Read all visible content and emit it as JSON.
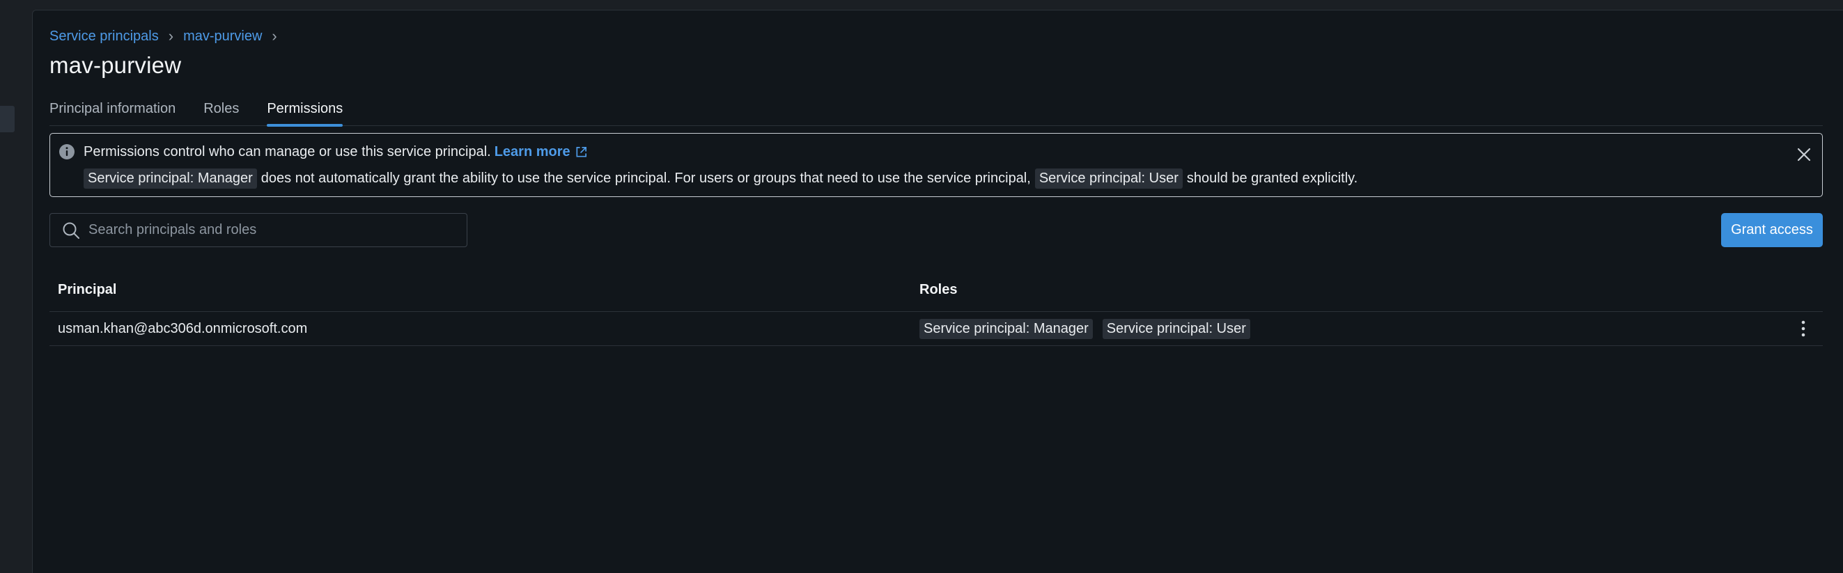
{
  "breadcrumb": {
    "items": [
      "Service principals",
      "mav-purview"
    ],
    "separator": "›"
  },
  "page": {
    "title": "mav-purview"
  },
  "tabs": [
    {
      "label": "Principal information",
      "active": false
    },
    {
      "label": "Roles",
      "active": false
    },
    {
      "label": "Permissions",
      "active": true
    }
  ],
  "alert": {
    "icon": "info-icon",
    "line1_text": "Permissions control who can manage or use this service principal.",
    "learn_more": "Learn more",
    "line2": {
      "chip1": "Service principal: Manager",
      "text1": "does not automatically grant the ability to use the service principal. For users or groups that need to use the service principal,",
      "chip2": "Service principal: User",
      "text2": "should be granted explicitly."
    }
  },
  "search": {
    "placeholder": "Search principals and roles",
    "value": ""
  },
  "grant_button": {
    "label": "Grant access"
  },
  "table": {
    "columns": [
      "Principal",
      "Roles"
    ],
    "rows": [
      {
        "principal": "usman.khan@abc306d.onmicrosoft.com",
        "roles": [
          "Service principal: Manager",
          "Service principal: User"
        ]
      }
    ]
  },
  "colors": {
    "accent": "#3a8fdc",
    "link": "#4e9be8",
    "background": "#11161b"
  }
}
